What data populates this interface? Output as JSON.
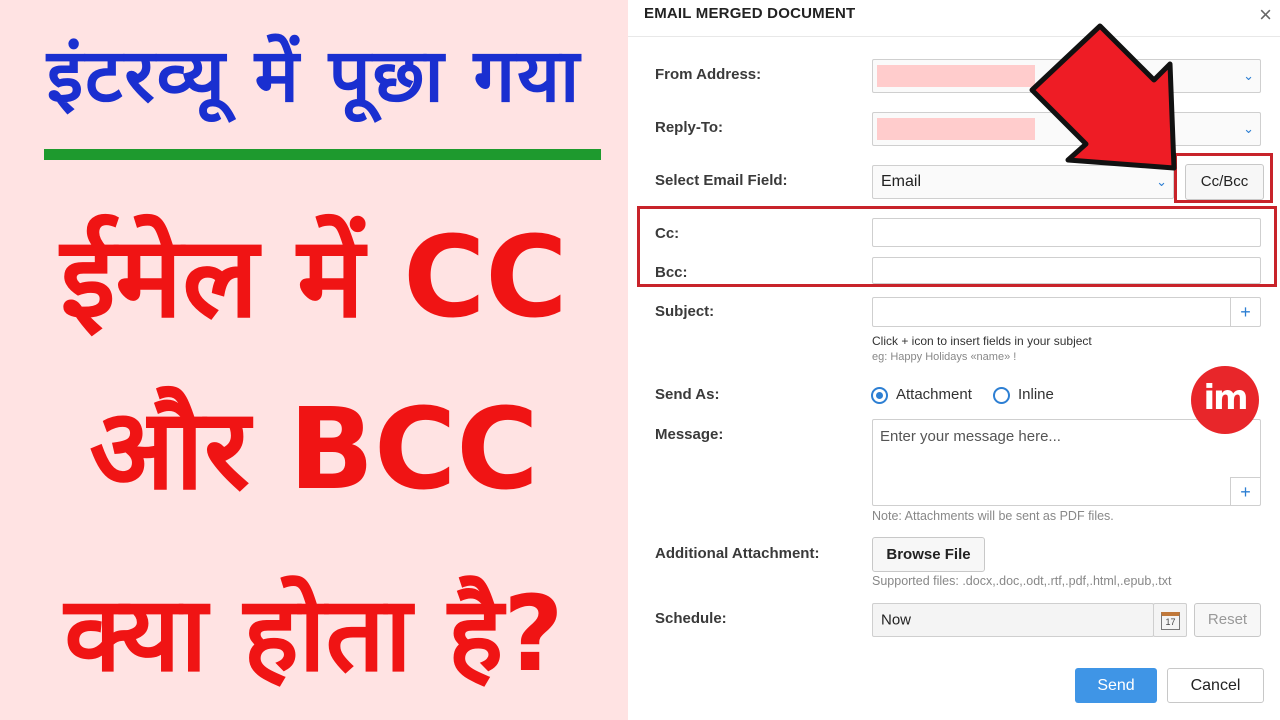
{
  "thumbnail": {
    "line1": "इंटरव्यू में पूछा गया",
    "line2": "ईमेल में CC",
    "line3": "और BCC",
    "line4": "क्या होता है?",
    "colors": {
      "blue": "#1a2fd0",
      "red": "#f01414",
      "green": "#1e9a2e",
      "bg": "#ffe3e3"
    }
  },
  "dialog": {
    "title": "EMAIL MERGED DOCUMENT",
    "close_icon": "×",
    "from_label": "From Address:",
    "reply_label": "Reply-To:",
    "select_email_label": "Select Email Field:",
    "select_email_value": "Email",
    "ccbcc_button": "Cc/Bcc",
    "cc_label": "Cc:",
    "bcc_label": "Bcc:",
    "subject_label": "Subject:",
    "subject_plus": "+",
    "subject_hint1": "Click + icon to insert fields in your subject",
    "subject_hint2": "eg: Happy Holidays «name» !",
    "send_as_label": "Send As:",
    "send_as_options": [
      "Attachment",
      "Inline"
    ],
    "send_as_selected": "Attachment",
    "message_label": "Message:",
    "message_placeholder": "Enter your message here...",
    "message_plus": "+",
    "message_note": "Note: Attachments will be sent as PDF files.",
    "attachment_label": "Additional Attachment:",
    "browse_button": "Browse File",
    "supported_files": "Supported files: .docx,.doc,.odt,.rtf,.pdf,.html,.epub,.txt",
    "schedule_label": "Schedule:",
    "schedule_value": "Now",
    "calendar_day": "17",
    "reset_button": "Reset",
    "send_button": "Send",
    "cancel_button": "Cancel",
    "chevron_icon": "⌄",
    "logo_text": "im",
    "accent_color": "#2d7fd3",
    "highlight_color": "#c8232a"
  }
}
